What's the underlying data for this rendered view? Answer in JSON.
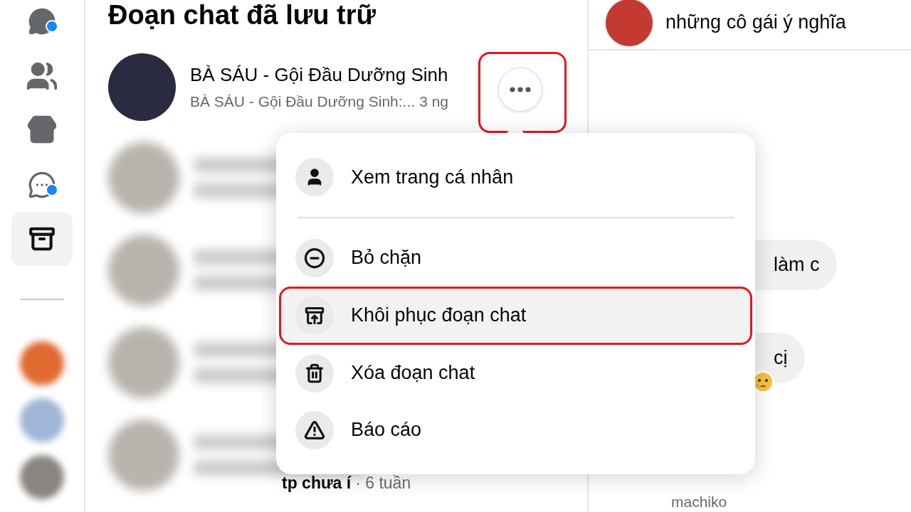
{
  "sidebar": {
    "items": [
      {
        "kind": "chats",
        "selected": false,
        "badge": true
      },
      {
        "kind": "people",
        "selected": false,
        "badge": false
      },
      {
        "kind": "marketplace",
        "selected": false,
        "badge": false
      },
      {
        "kind": "requests",
        "selected": false,
        "badge": true
      },
      {
        "kind": "archive",
        "selected": true,
        "badge": false
      }
    ],
    "shortcuts": [
      {
        "color": "#e06a30"
      },
      {
        "color": "#9fb6d6"
      },
      {
        "color": "#8a8580"
      }
    ]
  },
  "list": {
    "title": "Đoạn chat đã lưu trữ",
    "conversation": {
      "name": "BÀ SÁU - Gội Đầu Dưỡng Sinh",
      "preview": "BÀ SÁU - Gội Đầu Dưỡng Sinh:...",
      "time": "3 ng",
      "more_button": {
        "highlighted": true
      }
    },
    "footer_snippet": {
      "text": "tp chưa í",
      "time": "· 6 tuần"
    }
  },
  "menu": {
    "items": [
      {
        "kind": "profile",
        "label": "Xem trang cá nhân",
        "selected": false,
        "highlighted": false,
        "divider_after": true
      },
      {
        "kind": "unblock",
        "label": "Bỏ chặn",
        "selected": false,
        "highlighted": false,
        "divider_after": false
      },
      {
        "kind": "restore",
        "label": "Khôi phục đoạn chat",
        "selected": true,
        "highlighted": true,
        "divider_after": false
      },
      {
        "kind": "delete",
        "label": "Xóa đoạn chat",
        "selected": false,
        "highlighted": false,
        "divider_after": false
      },
      {
        "kind": "report",
        "label": "Báo cáo",
        "selected": false,
        "highlighted": false,
        "divider_after": false
      }
    ]
  },
  "chat": {
    "header": {
      "name": "những cô gái ý nghĩa"
    },
    "messages": [
      {
        "text": "làm c",
        "reaction": false
      },
      {
        "text": "cị",
        "reaction": true
      }
    ],
    "sender": "machiko"
  }
}
